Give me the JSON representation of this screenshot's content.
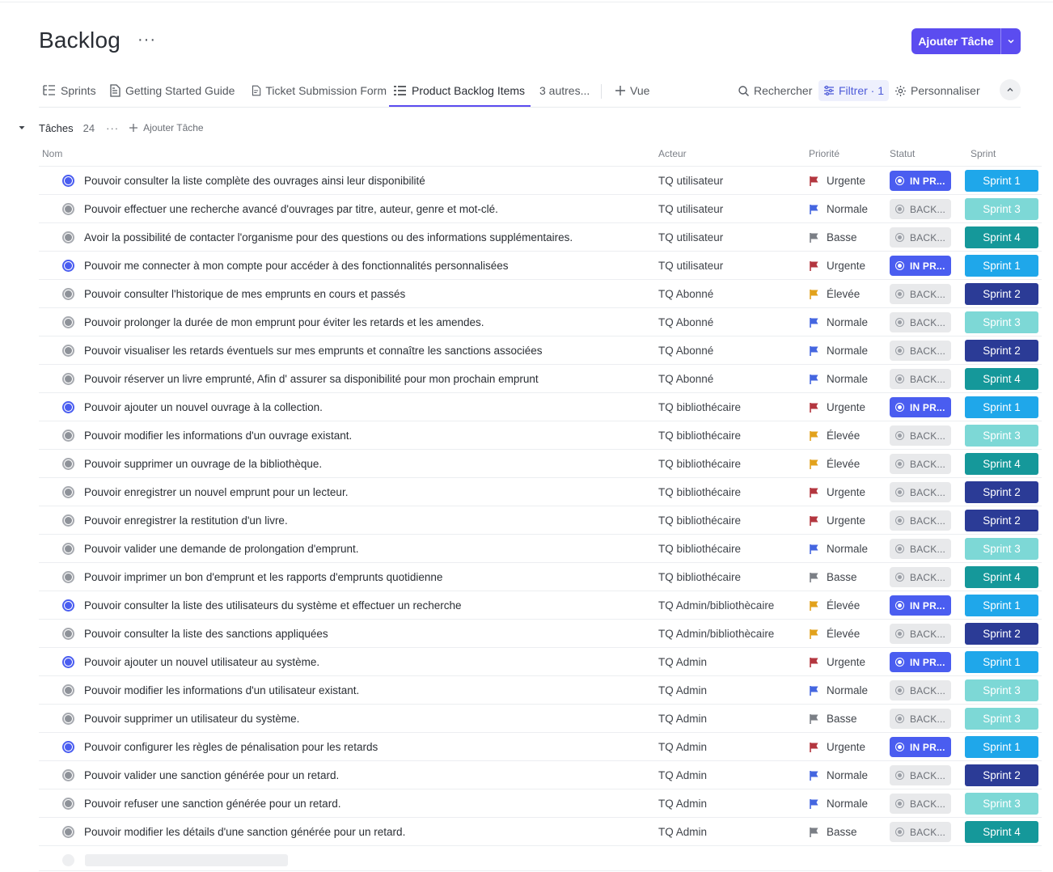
{
  "page": {
    "title": "Backlog",
    "more": "···",
    "add_task_label": "Ajouter Tâche"
  },
  "tabs": [
    {
      "label": "Sprints",
      "icon": "list-tree-icon"
    },
    {
      "label": "Getting Started Guide",
      "icon": "doc-icon"
    },
    {
      "label": "Ticket Submission Form",
      "icon": "form-icon"
    },
    {
      "label": "Product Backlog Items",
      "icon": "list-icon",
      "active": true
    }
  ],
  "tabs_more": "3 autres...",
  "add_view": "Vue",
  "tools": {
    "search": "Rechercher",
    "filter": "Filtrer · 1",
    "customize": "Personnaliser"
  },
  "group": {
    "name": "Tâches",
    "count": "24",
    "dots": "···",
    "add_label": "Ajouter Tâche"
  },
  "columns": {
    "name": "Nom",
    "actor": "Acteur",
    "priority": "Priorité",
    "status": "Statut",
    "sprint": "Sprint"
  },
  "status_labels": {
    "inprog": "IN PR...",
    "backlog": "BACK..."
  },
  "priority_colors": {
    "Urgente": "#b3363f",
    "Normale": "#4466e0",
    "Basse": "#7b7f86",
    "Élevée": "#e2a21c"
  },
  "sprint_colors": {
    "Sprint 1": "#1fa7ea",
    "Sprint 2": "#2b3b96",
    "Sprint 3": "#7dd8d6",
    "Sprint 4": "#15989a"
  },
  "tasks": [
    {
      "name": "Pouvoir consulter la liste complète des ouvrages ainsi leur disponibilité",
      "actor": "TQ utilisateur",
      "priority": "Urgente",
      "status": "inprog",
      "sprint": "Sprint 1"
    },
    {
      "name": "Pouvoir effectuer une recherche avancé d'ouvrages par titre, auteur, genre et mot-clé.",
      "actor": "TQ utilisateur",
      "priority": "Normale",
      "status": "backlog",
      "sprint": "Sprint 3"
    },
    {
      "name": "Avoir la possibilité de contacter l'organisme pour des questions ou des informations supplémentaires.",
      "actor": "TQ utilisateur",
      "priority": "Basse",
      "status": "backlog",
      "sprint": "Sprint 4"
    },
    {
      "name": "Pouvoir me connecter à mon compte pour accéder à des fonctionnalités personnalisées",
      "actor": "TQ utilisateur",
      "priority": "Urgente",
      "status": "inprog",
      "sprint": "Sprint 1"
    },
    {
      "name": "Pouvoir consulter l'historique de mes emprunts en cours et passés",
      "actor": "TQ Abonné",
      "priority": "Élevée",
      "status": "backlog",
      "sprint": "Sprint 2"
    },
    {
      "name": "Pouvoir prolonger la durée de mon emprunt pour éviter les retards et les amendes.",
      "actor": "TQ Abonné",
      "priority": "Normale",
      "status": "backlog",
      "sprint": "Sprint 3"
    },
    {
      "name": "Pouvoir visualiser les retards éventuels sur mes emprunts et connaître les sanctions associées",
      "actor": "TQ Abonné",
      "priority": "Normale",
      "status": "backlog",
      "sprint": "Sprint 2"
    },
    {
      "name": "Pouvoir réserver un livre emprunté, Afin d' assurer sa disponibilité pour mon prochain emprunt",
      "actor": "TQ Abonné",
      "priority": "Normale",
      "status": "backlog",
      "sprint": "Sprint 4"
    },
    {
      "name": "Pouvoir ajouter un nouvel ouvrage à la collection.",
      "actor": "TQ bibliothécaire",
      "priority": "Urgente",
      "status": "inprog",
      "sprint": "Sprint 1"
    },
    {
      "name": "Pouvoir modifier les informations d'un ouvrage existant.",
      "actor": "TQ bibliothécaire",
      "priority": "Élevée",
      "status": "backlog",
      "sprint": "Sprint 3"
    },
    {
      "name": "Pouvoir supprimer un ouvrage de la bibliothèque.",
      "actor": "TQ bibliothécaire",
      "priority": "Élevée",
      "status": "backlog",
      "sprint": "Sprint 4"
    },
    {
      "name": "Pouvoir enregistrer un nouvel emprunt pour un lecteur.",
      "actor": "TQ bibliothécaire",
      "priority": "Urgente",
      "status": "backlog",
      "sprint": "Sprint 2"
    },
    {
      "name": "Pouvoir enregistrer la restitution d'un livre.",
      "actor": "TQ bibliothécaire",
      "priority": "Urgente",
      "status": "backlog",
      "sprint": "Sprint 2"
    },
    {
      "name": "Pouvoir valider une demande de prolongation d'emprunt.",
      "actor": "TQ bibliothécaire",
      "priority": "Normale",
      "status": "backlog",
      "sprint": "Sprint 3"
    },
    {
      "name": "Pouvoir imprimer un bon d'emprunt et les rapports d'emprunts quotidienne",
      "actor": "TQ bibliothécaire",
      "priority": "Basse",
      "status": "backlog",
      "sprint": "Sprint 4"
    },
    {
      "name": "Pouvoir consulter la liste des utilisateurs du système et effectuer un recherche",
      "actor": "TQ Admin/bibliothècaire",
      "priority": "Élevée",
      "status": "inprog",
      "sprint": "Sprint 1"
    },
    {
      "name": "Pouvoir consulter la liste des sanctions appliquées",
      "actor": "TQ Admin/bibliothècaire",
      "priority": "Élevée",
      "status": "backlog",
      "sprint": "Sprint 2"
    },
    {
      "name": "Pouvoir ajouter un nouvel utilisateur au système.",
      "actor": "TQ Admin",
      "priority": "Urgente",
      "status": "inprog",
      "sprint": "Sprint 1"
    },
    {
      "name": "Pouvoir modifier les informations d'un utilisateur existant.",
      "actor": "TQ Admin",
      "priority": "Normale",
      "status": "backlog",
      "sprint": "Sprint 3"
    },
    {
      "name": "Pouvoir supprimer un utilisateur du système.",
      "actor": "TQ Admin",
      "priority": "Basse",
      "status": "backlog",
      "sprint": "Sprint 3"
    },
    {
      "name": "Pouvoir configurer les règles de pénalisation pour les retards",
      "actor": "TQ Admin",
      "priority": "Urgente",
      "status": "inprog",
      "sprint": "Sprint 1"
    },
    {
      "name": "Pouvoir valider une sanction générée pour un retard.",
      "actor": "TQ Admin",
      "priority": "Normale",
      "status": "backlog",
      "sprint": "Sprint 2"
    },
    {
      "name": "Pouvoir refuser une sanction générée pour un retard.",
      "actor": "TQ Admin",
      "priority": "Normale",
      "status": "backlog",
      "sprint": "Sprint 3"
    },
    {
      "name": "Pouvoir modifier les détails d'une sanction générée pour un retard.",
      "actor": "TQ Admin",
      "priority": "Basse",
      "status": "backlog",
      "sprint": "Sprint 4"
    }
  ]
}
